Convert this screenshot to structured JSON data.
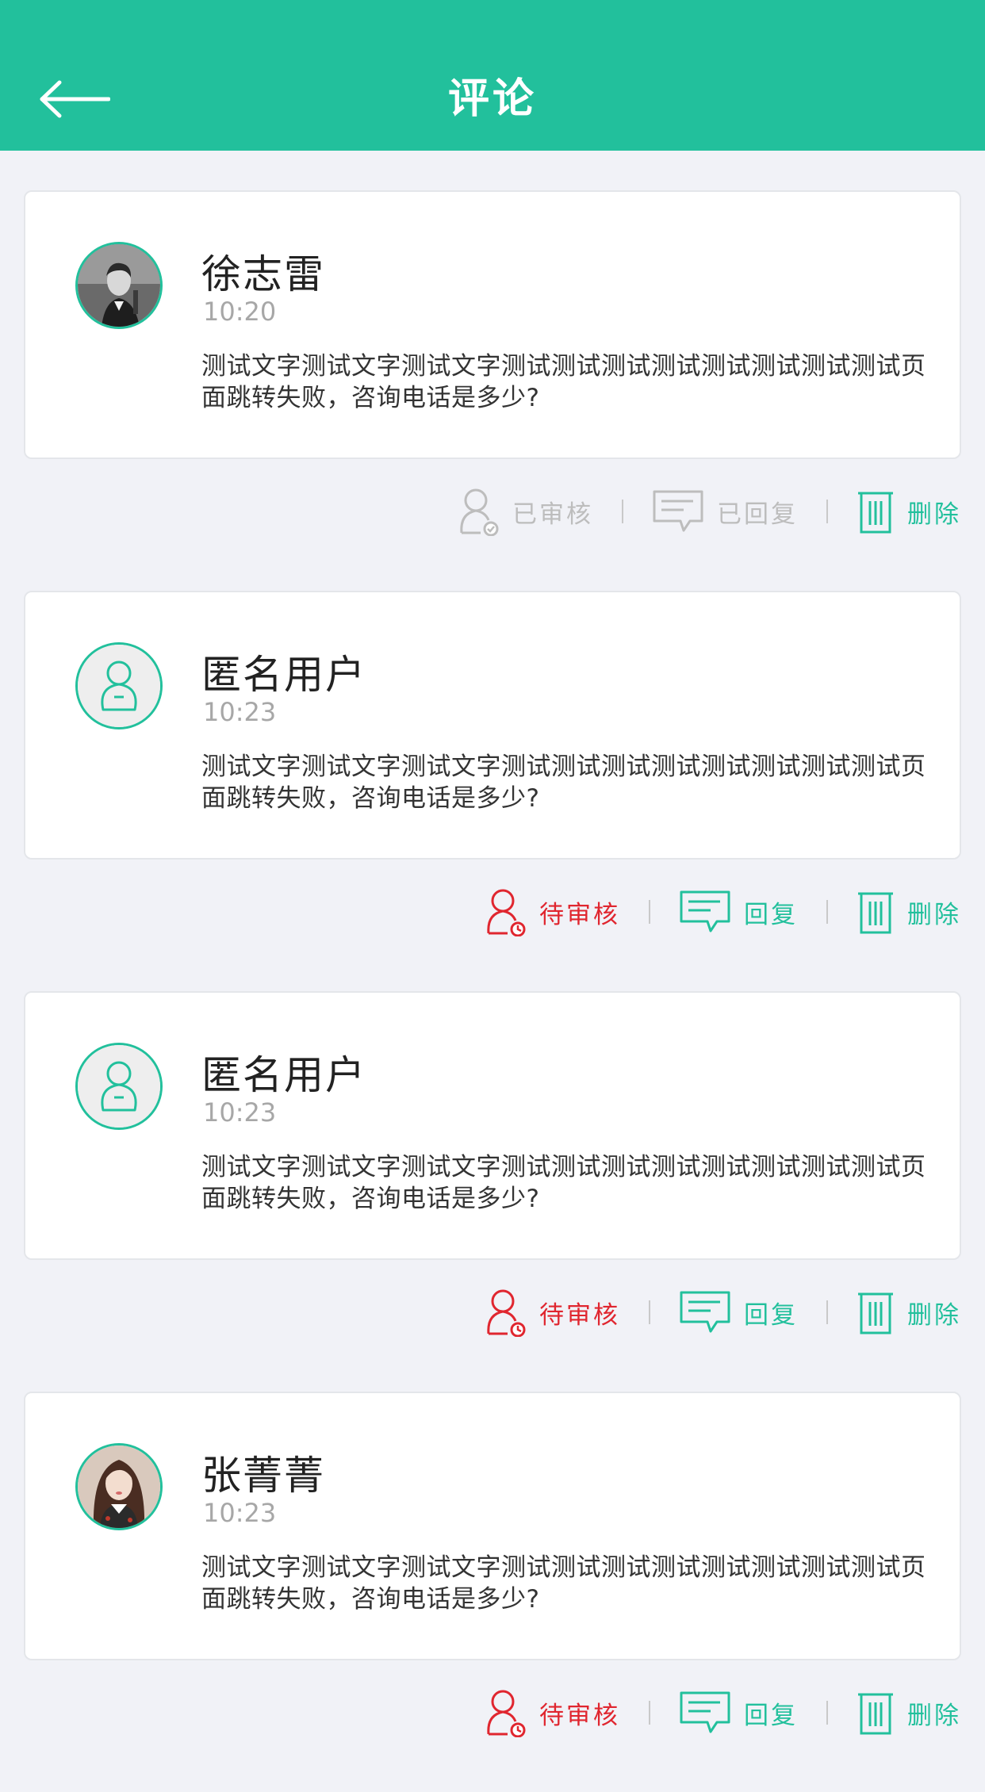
{
  "header": {
    "title": "评论",
    "back_icon": "arrow-left-icon"
  },
  "colors": {
    "primary": "#22c09c",
    "pending": "#e0262f",
    "disabled": "#bdbdbd",
    "background": "#f1f2f7"
  },
  "comments": [
    {
      "name": "徐志雷",
      "time": "10:20",
      "content": "测试文字测试文字测试文字测试测试测试测试测试测试测试测试页面跳转失败，咨询电话是多少?",
      "avatar": "male-photo-avatar",
      "status_label": "已审核",
      "reply_label": "已回复",
      "delete_label": "删除"
    },
    {
      "name": "匿名用户",
      "time": "10:23",
      "content": "测试文字测试文字测试文字测试测试测试测试测试测试测试测试页面跳转失败，咨询电话是多少?",
      "avatar": "anonymous-user-avatar",
      "status_label": "待审核",
      "reply_label": "回复",
      "delete_label": "删除"
    },
    {
      "name": "匿名用户",
      "time": "10:23",
      "content": "测试文字测试文字测试文字测试测试测试测试测试测试测试测试页面跳转失败，咨询电话是多少?",
      "avatar": "anonymous-user-avatar",
      "status_label": "待审核",
      "reply_label": "回复",
      "delete_label": "删除"
    },
    {
      "name": "张菁菁",
      "time": "10:23",
      "content": "测试文字测试文字测试文字测试测试测试测试测试测试测试测试页面跳转失败，咨询电话是多少?",
      "avatar": "female-photo-avatar",
      "status_label": "待审核",
      "reply_label": "回复",
      "delete_label": "删除"
    }
  ]
}
